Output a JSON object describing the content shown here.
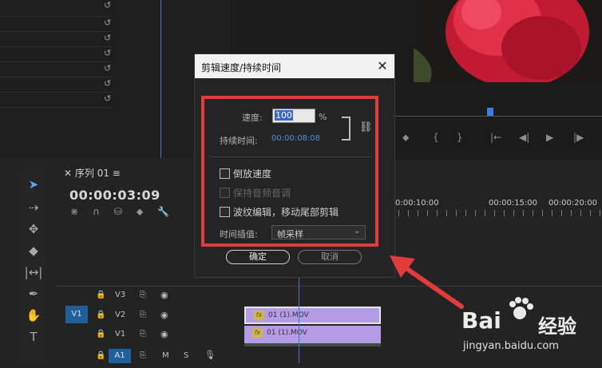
{
  "dialog": {
    "title": "剪辑速度/持续时间",
    "close": "✕",
    "speed_label": "速度:",
    "speed_value": "100",
    "speed_unit": "%",
    "duration_label": "持续时间:",
    "duration_value": "00:00:08:08",
    "reverse_label": "倒放速度",
    "pitch_label": "保持音频音调",
    "ripple_label": "波纹编辑，移动尾部剪辑",
    "interp_label": "时间插值:",
    "interp_value": "帧采样",
    "ok": "确定",
    "cancel": "取消"
  },
  "sequence": {
    "tab": "序列 01",
    "timecode": "00:00:03:09",
    "ruler": [
      "0:00:10:00",
      "00:00:15:00",
      "00:00:20:00"
    ]
  },
  "tracks": [
    {
      "name": "V3",
      "source": ""
    },
    {
      "name": "V2",
      "source": "V1"
    },
    {
      "name": "V1",
      "source": ""
    },
    {
      "name": "A1",
      "source": ""
    }
  ],
  "clips": [
    {
      "fx": "fx",
      "label": "01 (1).MOV"
    },
    {
      "fx": "fx",
      "label": "01 (1).MOV"
    }
  ],
  "watermark": {
    "brand": "Bai",
    "brand2": "经验",
    "url": "jingyan.baidu.com"
  },
  "colors": {
    "accent": "#3b66c6",
    "highlight": "#e23b3b",
    "clip": "#b39be6",
    "track_active": "#1f5f9c"
  }
}
